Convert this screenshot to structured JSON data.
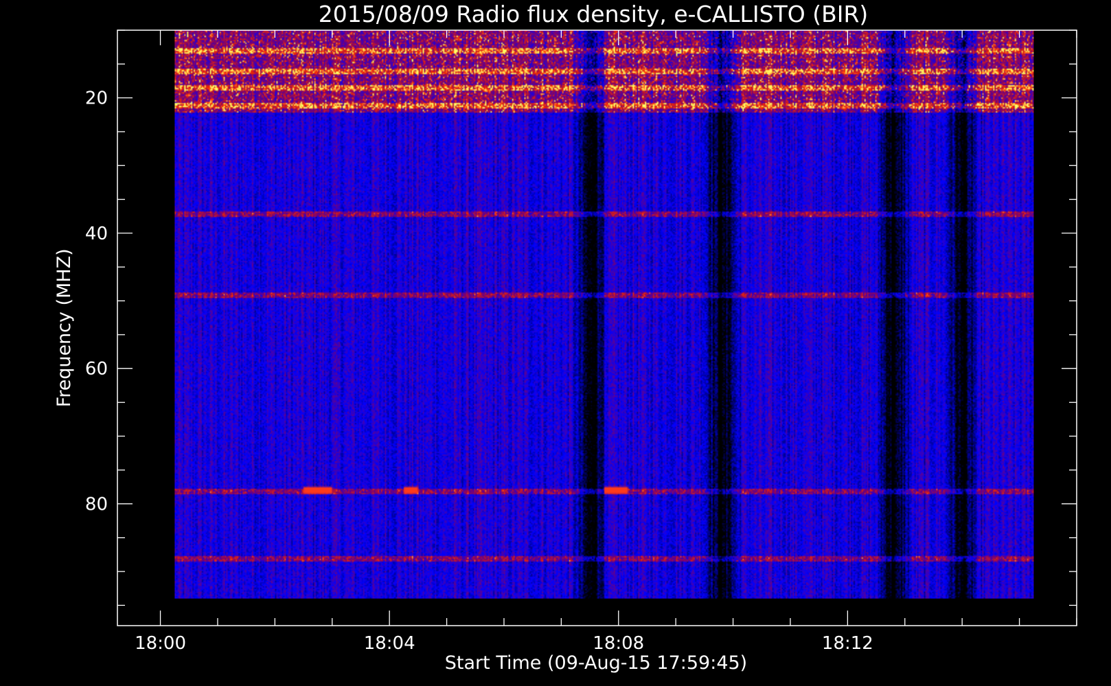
{
  "chart_data": {
    "type": "heatmap",
    "title": "2015/08/09  Radio flux density, e-CALLISTO (BIR)",
    "xlabel": "Start Time (09-Aug-15 17:59:45)",
    "ylabel": "Frequency (MHZ)",
    "x_unit": "UT",
    "x_range": [
      "17:59:15",
      "18:16:00"
    ],
    "data_x_range": [
      "18:00:15",
      "18:15:15"
    ],
    "y_range": [
      10,
      98
    ],
    "y_inverted": true,
    "data_y_range": [
      10,
      94
    ],
    "x_ticks": [
      "18:00",
      "18:04",
      "18:08",
      "18:12"
    ],
    "x_minor_per_major": 4,
    "y_ticks": [
      20,
      40,
      60,
      80
    ],
    "y_minor_step": 5,
    "grid": false,
    "colormap": [
      "#000000",
      "#0000ff",
      "#c82a00",
      "#ffff66"
    ],
    "dark_columns_minutes": [
      7.5,
      12.8,
      14.0,
      9.8
    ],
    "horizontal_features_mhz": [
      13,
      16,
      18.5,
      21,
      37,
      49,
      78,
      88
    ],
    "bursts": [
      {
        "start": "18:02:30",
        "end": "18:03:00",
        "freq_mhz": 78
      },
      {
        "start": "18:04:15",
        "end": "18:04:30",
        "freq_mhz": 78
      },
      {
        "start": "18:07:45",
        "end": "18:08:10",
        "freq_mhz": 78
      }
    ]
  }
}
